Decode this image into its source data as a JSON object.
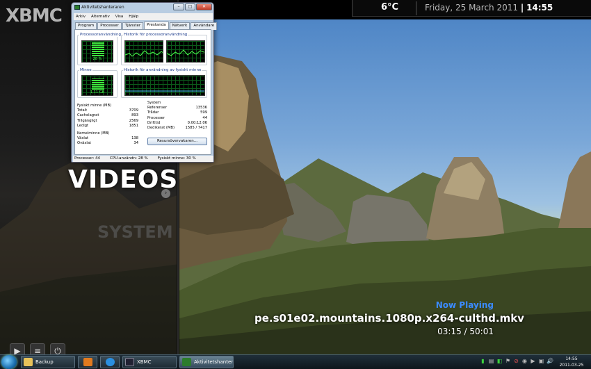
{
  "xbmc": {
    "logo_text": "XBMC",
    "menu": {
      "active": "VIDEOS",
      "next": "SYSTEM"
    },
    "weather": {
      "temperature": "6°C"
    },
    "date": "Friday, 25 March 2011",
    "separator": "|",
    "time": "14:55",
    "now_playing": {
      "label": "Now Playing",
      "file": "pe.s01e02.mountains.1080p.x264-culthd.mkv",
      "position": "03:15 / 50:01"
    },
    "controls": {
      "play_glyph": "▶",
      "playlist_glyph": "≡",
      "power_glyph": "⏻",
      "arrow_glyph": "›"
    }
  },
  "task_manager": {
    "title": "Aktivitetshanteraren",
    "window_buttons": {
      "minimize": "–",
      "maximize": "□",
      "close": "✕"
    },
    "menu": [
      "Arkiv",
      "Alternativ",
      "Visa",
      "Hjälp"
    ],
    "tabs": [
      "Program",
      "Processer",
      "Tjänster",
      "Prestanda",
      "Nätverk",
      "Användare"
    ],
    "active_tab": "Prestanda",
    "cpu_usage": {
      "label": "Processoranvändning",
      "value": "28 %",
      "percent": 28
    },
    "cpu_history": {
      "label": "Historik för processoranvändning"
    },
    "memory": {
      "label": "Minne",
      "value": "1,11 GB",
      "percent": 30
    },
    "memory_history": {
      "label": "Historik för användning av fysiskt minne"
    },
    "physical_memory": {
      "label": "Fysiskt minne (MB)",
      "rows": [
        {
          "k": "Totalt",
          "v": "3709"
        },
        {
          "k": "Cachelagrat",
          "v": "893"
        },
        {
          "k": "Tillgängligt",
          "v": "2569"
        },
        {
          "k": "Ledigt",
          "v": "1851"
        }
      ]
    },
    "kernel_memory": {
      "label": "Kernelminne (MB)",
      "rows": [
        {
          "k": "Växlat",
          "v": "138"
        },
        {
          "k": "Oväxlat",
          "v": "34"
        }
      ]
    },
    "system": {
      "label": "System",
      "rows": [
        {
          "k": "Referenser",
          "v": "13536"
        },
        {
          "k": "Trådar",
          "v": "599"
        },
        {
          "k": "Processer",
          "v": "44"
        },
        {
          "k": "Drifttid",
          "v": "0:00:12:06"
        },
        {
          "k": "Dedikerat (MB)",
          "v": "1585 / 7417"
        }
      ]
    },
    "resource_button": "Resursövervakaren...",
    "status": {
      "processes": "Processer: 44",
      "cpu": "CPU-användn: 28 %",
      "memory": "Fysiskt minne: 30 %"
    }
  },
  "taskbar": {
    "buttons": [
      {
        "label": "Backup",
        "icon": "folder-icon"
      },
      {
        "label": "",
        "icon": "media-player-icon"
      },
      {
        "label": "",
        "icon": "internet-explorer-icon"
      },
      {
        "label": "XBMC",
        "icon": "xbmc-icon"
      },
      {
        "label": "Aktivitetshanteraren",
        "icon": "task-manager-icon"
      }
    ],
    "tray_glyphs": [
      "▮",
      "▤",
      "◧",
      "⚑",
      "⊘",
      "◉",
      "▶",
      "▣",
      "🔊"
    ],
    "clock_time": "14:55",
    "clock_date": "2011-03-25"
  },
  "colors": {
    "accent_now_playing": "#3b8bff",
    "cpu_graph": "#4cff4c",
    "mem_graph": "#4ad0ff"
  }
}
